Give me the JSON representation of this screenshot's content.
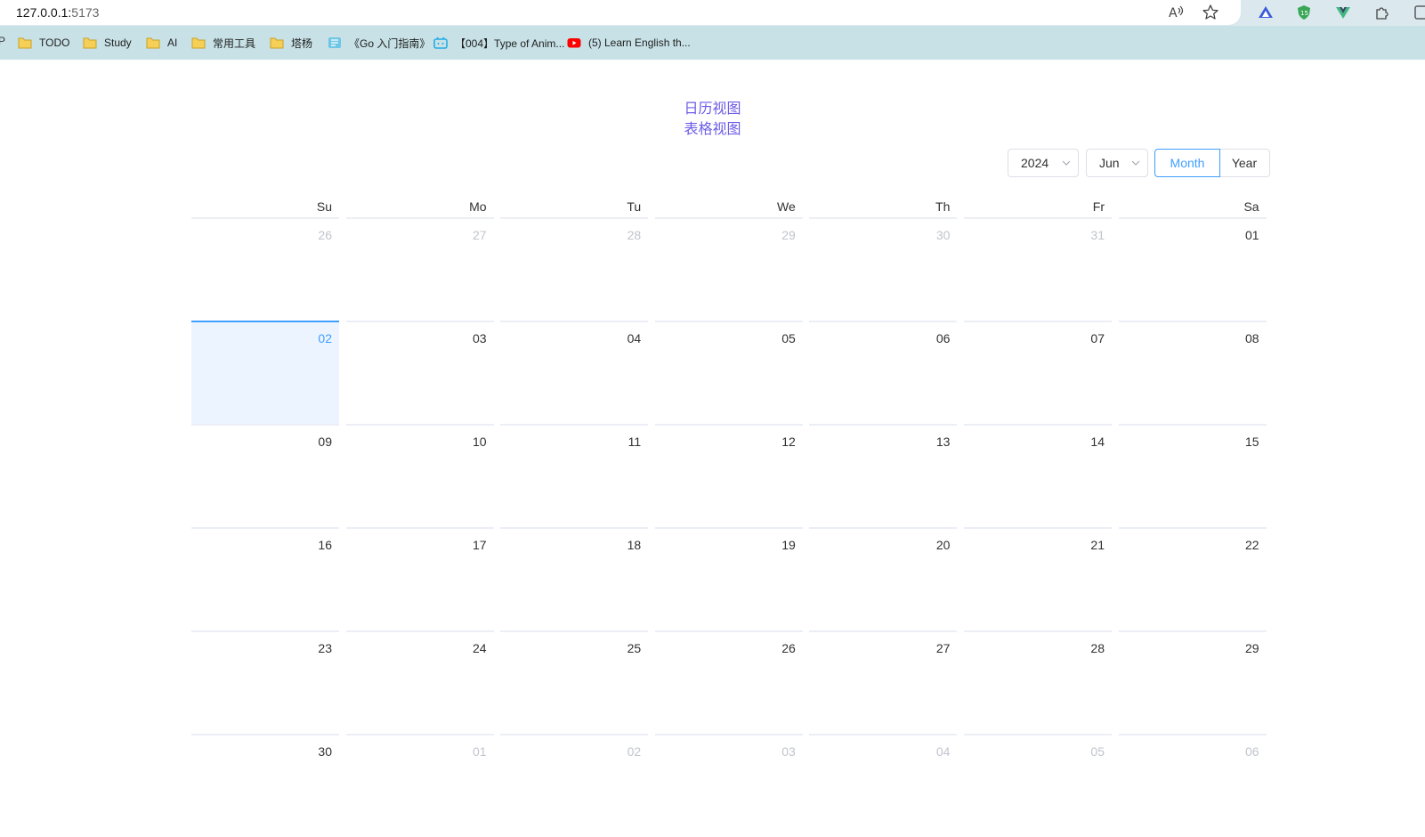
{
  "browser": {
    "url_host": "127.0.0.1:",
    "url_port": "5173",
    "bookmark_edge": "P",
    "bookmarks": [
      {
        "label": "TODO",
        "icon": "folder-icon"
      },
      {
        "label": "Study",
        "icon": "folder-icon"
      },
      {
        "label": "AI",
        "icon": "folder-icon"
      },
      {
        "label": "常用工具",
        "icon": "folder-icon"
      },
      {
        "label": "塔杨",
        "icon": "folder-icon"
      },
      {
        "label": "《Go 入门指南》",
        "icon": "gitbook-icon"
      },
      {
        "label": "【004】Type of Anim...",
        "icon": "bilibili-icon"
      },
      {
        "label": "(5) Learn English th...",
        "icon": "youtube-icon"
      }
    ]
  },
  "page": {
    "views": [
      "日历视图",
      "表格视图"
    ]
  },
  "calendar": {
    "year": "2024",
    "month": "Jun",
    "mode_month": "Month",
    "mode_year": "Year",
    "weekdays": [
      "Su",
      "Mo",
      "Tu",
      "We",
      "Th",
      "Fr",
      "Sa"
    ],
    "selected": "02",
    "weeks": [
      [
        {
          "d": "26",
          "o": true
        },
        {
          "d": "27",
          "o": true
        },
        {
          "d": "28",
          "o": true
        },
        {
          "d": "29",
          "o": true
        },
        {
          "d": "30",
          "o": true
        },
        {
          "d": "31",
          "o": true
        },
        {
          "d": "01",
          "o": false
        }
      ],
      [
        {
          "d": "02",
          "o": false,
          "s": true
        },
        {
          "d": "03",
          "o": false
        },
        {
          "d": "04",
          "o": false
        },
        {
          "d": "05",
          "o": false
        },
        {
          "d": "06",
          "o": false
        },
        {
          "d": "07",
          "o": false
        },
        {
          "d": "08",
          "o": false
        }
      ],
      [
        {
          "d": "09",
          "o": false
        },
        {
          "d": "10",
          "o": false
        },
        {
          "d": "11",
          "o": false
        },
        {
          "d": "12",
          "o": false
        },
        {
          "d": "13",
          "o": false
        },
        {
          "d": "14",
          "o": false
        },
        {
          "d": "15",
          "o": false
        }
      ],
      [
        {
          "d": "16",
          "o": false
        },
        {
          "d": "17",
          "o": false
        },
        {
          "d": "18",
          "o": false
        },
        {
          "d": "19",
          "o": false
        },
        {
          "d": "20",
          "o": false
        },
        {
          "d": "21",
          "o": false
        },
        {
          "d": "22",
          "o": false
        }
      ],
      [
        {
          "d": "23",
          "o": false
        },
        {
          "d": "24",
          "o": false
        },
        {
          "d": "25",
          "o": false
        },
        {
          "d": "26",
          "o": false
        },
        {
          "d": "27",
          "o": false
        },
        {
          "d": "28",
          "o": false
        },
        {
          "d": "29",
          "o": false
        }
      ],
      [
        {
          "d": "30",
          "o": false
        },
        {
          "d": "01",
          "o": true
        },
        {
          "d": "02",
          "o": true
        },
        {
          "d": "03",
          "o": true
        },
        {
          "d": "04",
          "o": true
        },
        {
          "d": "05",
          "o": true
        },
        {
          "d": "06",
          "o": true
        }
      ]
    ]
  }
}
